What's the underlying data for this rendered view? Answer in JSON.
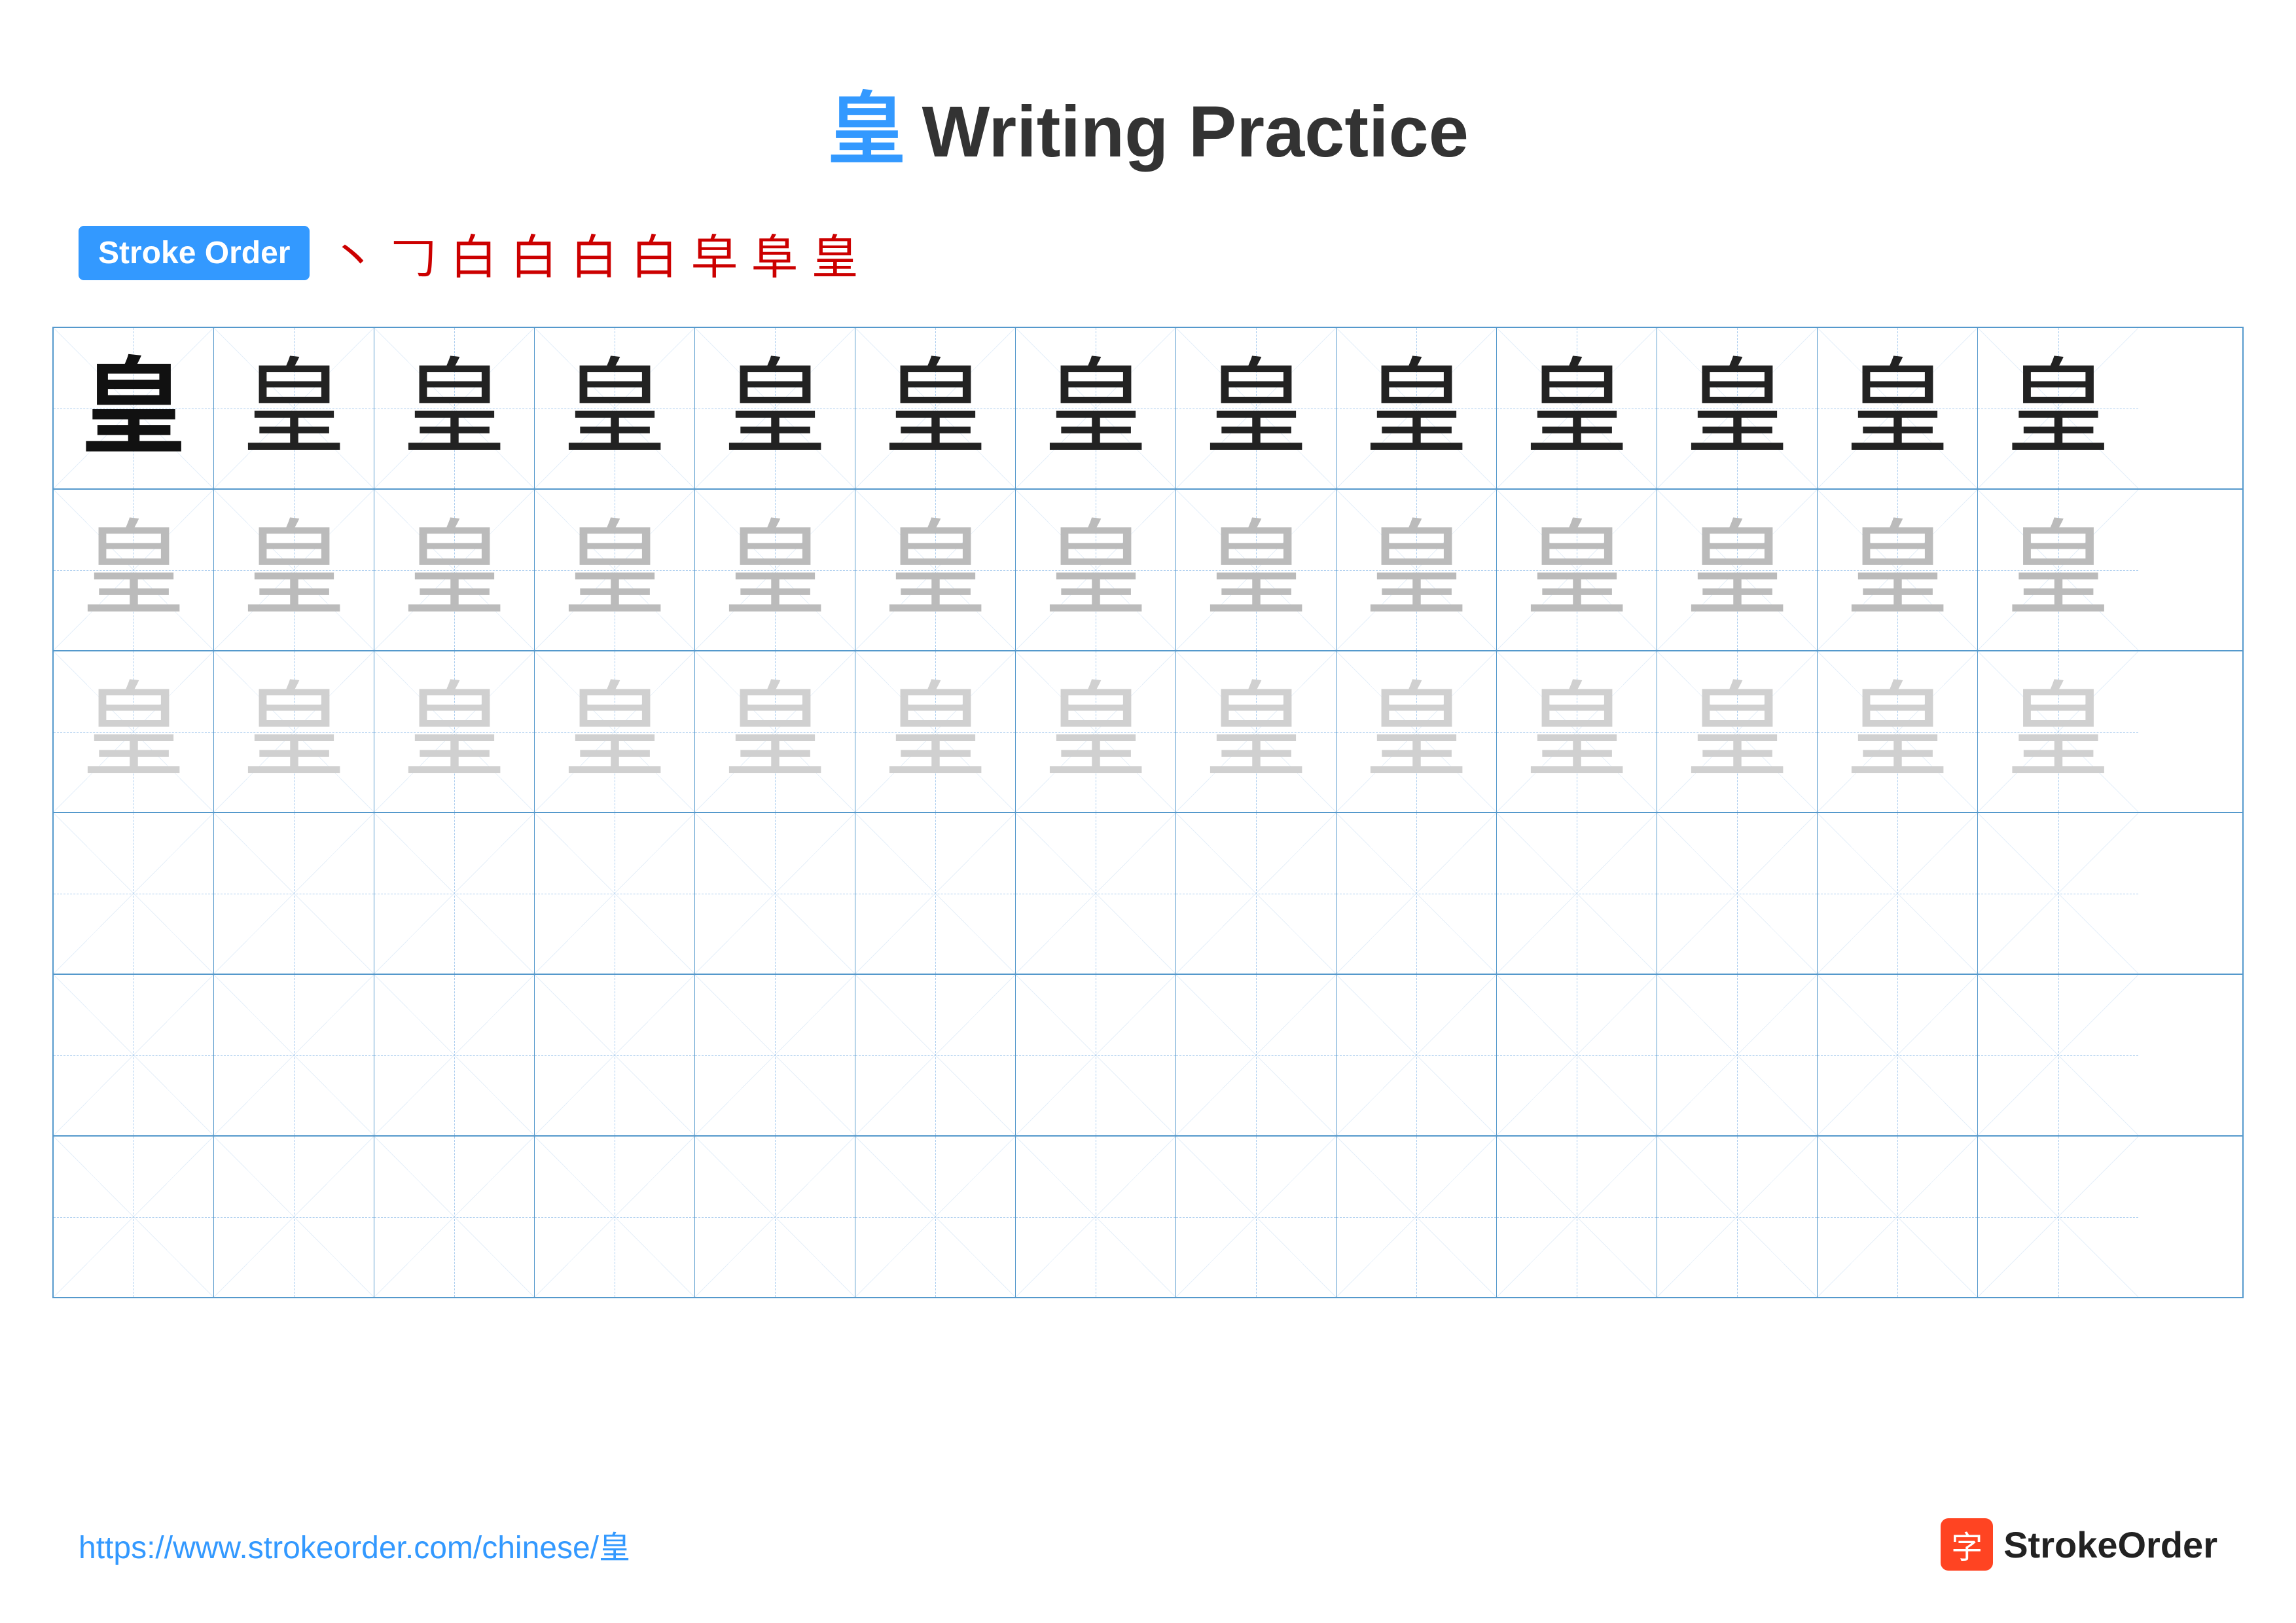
{
  "title": {
    "char": "皇",
    "text": "Writing Practice"
  },
  "stroke_order": {
    "badge_label": "Stroke Order",
    "strokes": [
      "丶",
      "𠃌",
      "白",
      "白",
      "白",
      "白",
      "皁",
      "阜",
      "皇"
    ]
  },
  "grid": {
    "rows": 6,
    "cols": 13,
    "character": "皇",
    "row_types": [
      "dark",
      "medium_gray",
      "light_gray",
      "empty",
      "empty",
      "empty"
    ]
  },
  "footer": {
    "url": "https://www.strokeorder.com/chinese/皇",
    "logo_char": "字",
    "logo_name": "StrokeOrder"
  }
}
